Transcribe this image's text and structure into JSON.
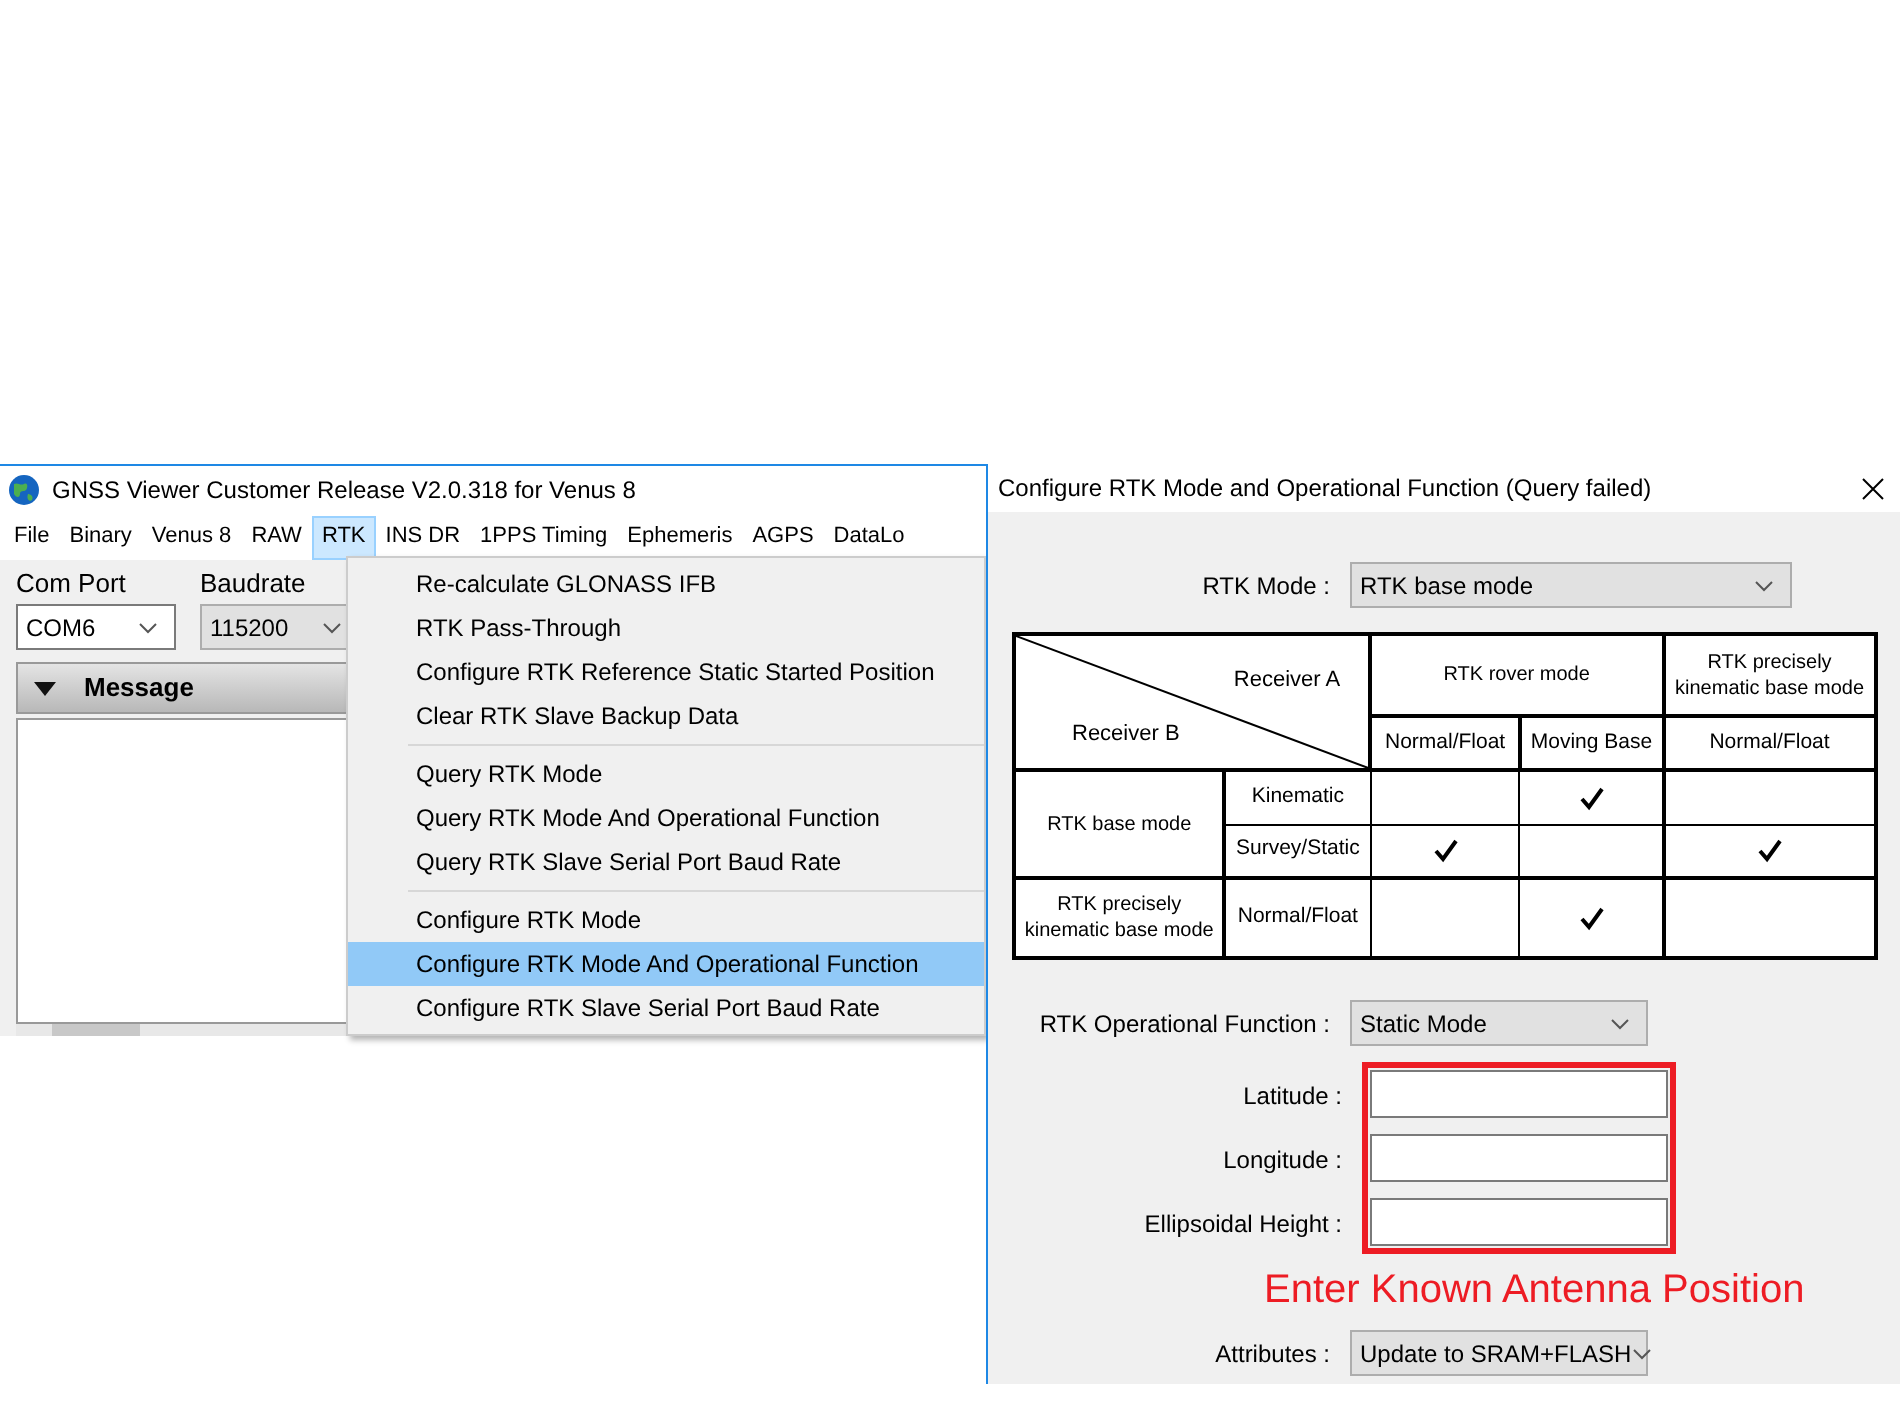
{
  "app_window": {
    "title": "GNSS Viewer Customer Release V2.0.318 for Venus 8",
    "menu": [
      {
        "label": "File",
        "selected": false
      },
      {
        "label": "Binary",
        "selected": false
      },
      {
        "label": "Venus 8",
        "selected": false
      },
      {
        "label": "RAW",
        "selected": false
      },
      {
        "label": "RTK",
        "selected": true
      },
      {
        "label": "INS DR",
        "selected": false
      },
      {
        "label": "1PPS Timing",
        "selected": false
      },
      {
        "label": "Ephemeris",
        "selected": false
      },
      {
        "label": "AGPS",
        "selected": false
      },
      {
        "label": "DataLo",
        "selected": false
      }
    ],
    "com_port": {
      "label": "Com Port",
      "value": "COM6"
    },
    "baudrate": {
      "label": "Baudrate",
      "value": "115200"
    },
    "message_panel": {
      "title": "Message"
    }
  },
  "rtk_menu": {
    "groups": [
      [
        {
          "label": "Re-calculate GLONASS IFB",
          "selected": false
        },
        {
          "label": "RTK Pass-Through",
          "selected": false
        },
        {
          "label": "Configure RTK Reference Static Started Position",
          "selected": false
        },
        {
          "label": "Clear RTK Slave Backup Data",
          "selected": false
        }
      ],
      [
        {
          "label": "Query RTK Mode",
          "selected": false
        },
        {
          "label": "Query RTK Mode And Operational Function",
          "selected": false
        },
        {
          "label": "Query RTK Slave Serial Port Baud Rate",
          "selected": false
        }
      ],
      [
        {
          "label": "Configure RTK Mode",
          "selected": false
        },
        {
          "label": "Configure RTK Mode And Operational Function",
          "selected": true
        },
        {
          "label": "Configure RTK Slave Serial Port Baud Rate",
          "selected": false
        }
      ]
    ]
  },
  "dialog": {
    "title": "Configure RTK Mode and Operational Function (Query failed)",
    "rtk_mode": {
      "label": "RTK Mode :",
      "value": "RTK base mode"
    },
    "table": {
      "corner": {
        "column_heading": "Receiver A",
        "row_heading": "Receiver B"
      },
      "column_groups": [
        {
          "label": "RTK rover mode",
          "columns": [
            "Normal/Float",
            "Moving Base"
          ]
        },
        {
          "label": "RTK precisely kinematic base mode",
          "columns": [
            "Normal/Float"
          ]
        }
      ],
      "row_groups": [
        {
          "label": "RTK base mode",
          "rows": [
            {
              "label": "Kinematic",
              "checks": [
                false,
                true,
                false
              ]
            },
            {
              "label": "Survey/Static",
              "checks": [
                true,
                false,
                true
              ]
            }
          ]
        },
        {
          "label": "RTK precisely kinematic base mode",
          "rows": [
            {
              "label": "Normal/Float",
              "checks": [
                false,
                true,
                false
              ]
            }
          ]
        }
      ]
    },
    "operational_function": {
      "label": "RTK Operational Function :",
      "value": "Static Mode"
    },
    "position_fields": [
      {
        "label": "Latitude :"
      },
      {
        "label": "Longitude :"
      },
      {
        "label": "Ellipsoidal Height :"
      }
    ],
    "note": "Enter Known Antenna Position",
    "attributes": {
      "label": "Attributes :",
      "value": "Update to SRAM+FLASH"
    }
  }
}
